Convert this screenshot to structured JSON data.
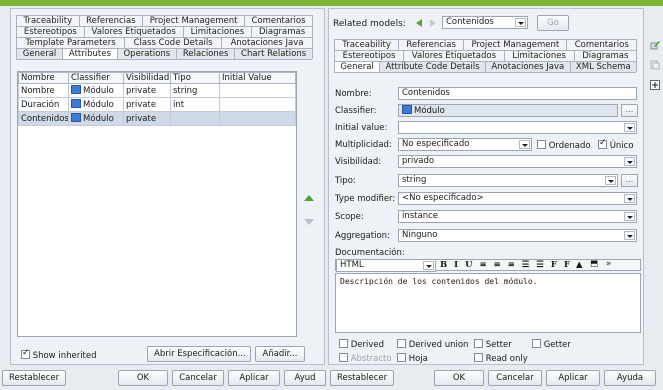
{
  "left": {
    "tabs_row1": [
      "Traceability",
      "Referencias",
      "Project Management",
      "Comentarios"
    ],
    "tabs_row2": [
      "Estereotipos",
      "Valores Etiquetados",
      "Limitaciones",
      "Diagramas"
    ],
    "tabs_row3": [
      "Template Parameters",
      "Class Code Details",
      "Anotaciones Java"
    ],
    "tabs_row4": [
      "General",
      "Attributes",
      "Operations",
      "Relaciones",
      "Chart Relations"
    ],
    "active_tab": "Attributes",
    "table": {
      "headers": [
        "Nombre",
        "Classifier",
        "Visibilidad",
        "Tipo",
        "Initial Value"
      ],
      "rows": [
        {
          "name": "Nombre",
          "classifier": "Módulo",
          "visibility": "private",
          "type": "string",
          "initial": "",
          "selected": false
        },
        {
          "name": "Duración",
          "classifier": "Módulo",
          "visibility": "private",
          "type": "int",
          "initial": "",
          "selected": false
        },
        {
          "name": "Contenidos",
          "classifier": "Módulo",
          "visibility": "private",
          "type": "",
          "initial": "",
          "selected": true
        }
      ]
    },
    "show_inherited_label": "Show inherited",
    "show_inherited_checked": true,
    "open_spec_button": "Abrir Especificación...",
    "add_button": "Añadir...",
    "footer": {
      "reset": "Restablecer",
      "ok": "OK",
      "cancel": "Cancelar",
      "apply": "Aplicar",
      "help": "Ayud"
    }
  },
  "right": {
    "related_models_label": "Related models:",
    "related_models_value": "Contenidos",
    "go_button": "Go",
    "tabs_row1": [
      "Traceability",
      "Referencias",
      "Project Management",
      "Comentarios"
    ],
    "tabs_row2": [
      "Estereotipos",
      "Valores Etiquetados",
      "Limitaciones",
      "Diagramas"
    ],
    "tabs_row3": [
      "General",
      "Attribute Code Details",
      "Anotaciones Java",
      "XML Schema"
    ],
    "active_tab": "General",
    "form": {
      "name_label": "Nombre:",
      "name_value": "Contenidos",
      "classifier_label": "Classifier:",
      "classifier_value": "Módulo",
      "initial_label": "Initial value:",
      "initial_value": "",
      "multiplicity_label": "Multiplicidad:",
      "multiplicity_value": "No especificado",
      "ordered_label": "Ordenado",
      "ordered_checked": false,
      "unique_label": "Único",
      "unique_checked": true,
      "visibility_label": "Visibilidad:",
      "visibility_value": "privado",
      "type_label": "Tipo:",
      "type_value": "string",
      "type_modifier_label": "Type modifier:",
      "type_modifier_value": "<No especificado>",
      "scope_label": "Scope:",
      "scope_value": "instance",
      "aggregation_label": "Aggregation:",
      "aggregation_value": "Ninguno",
      "documentation_label": "Documentación:",
      "doc_format": "HTML",
      "doc_toolbar": "B I U ≡ ≡ ≡ ☰ ☰ F F",
      "doc_text": "Descripción de los contenidos del módulo."
    },
    "flags": {
      "derived": "Derived",
      "derived_union": "Derived union",
      "setter": "Setter",
      "getter": "Getter",
      "abstract": "Abstracto",
      "leaf": "Hoja",
      "read_only": "Read only"
    },
    "footer": {
      "reset": "Restablecer",
      "ok": "OK",
      "cancel": "Cancelar",
      "apply": "Aplicar",
      "help": "Ayuda"
    }
  },
  "colors": {
    "accent_green": "#7db332",
    "selection": "#cfd9e8",
    "readonly": "#dfe6ef"
  }
}
